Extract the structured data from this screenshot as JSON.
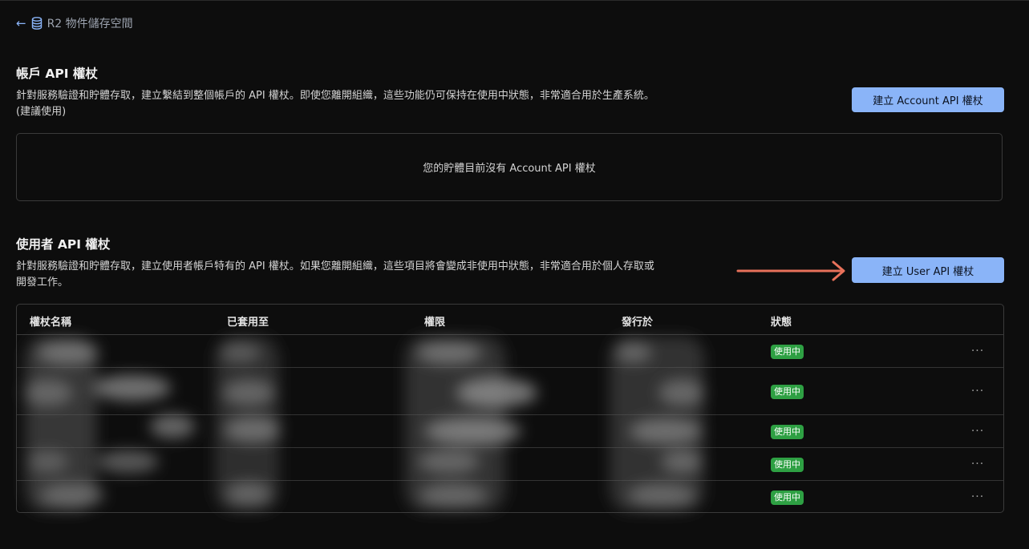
{
  "breadcrumb": {
    "back_icon": "arrow-left-icon",
    "db_icon": "database-icon",
    "label": "R2 物件儲存空間"
  },
  "account_section": {
    "title": "帳戶 API 權杖",
    "description": "針對服務驗證和貯體存取，建立繫結到整個帳戶的 API 權杖。即使您離開組織，這些功能仍可保持在使用中狀態，非常適合用於生產系統。(建議使用)",
    "button_label": "建立 Account API 權杖",
    "empty_message": "您的貯體目前沒有 Account API 權杖"
  },
  "user_section": {
    "title": "使用者 API 權杖",
    "description": "針對服務驗證和貯體存取，建立使用者帳戶特有的 API 權杖。如果您離開組織，這些項目將會變成非使用中狀態，非常適合用於個人存取或開發工作。",
    "button_label": "建立 User API 權杖"
  },
  "table": {
    "columns": [
      "權杖名稱",
      "已套用至",
      "權限",
      "發行於",
      "狀態"
    ],
    "rows": [
      {
        "status": "使用中",
        "menu": "···"
      },
      {
        "status": "使用中",
        "menu": "···"
      },
      {
        "status": "使用中",
        "menu": "···"
      },
      {
        "status": "使用中",
        "menu": "···"
      },
      {
        "status": "使用中",
        "menu": "···"
      }
    ]
  },
  "colors": {
    "accent": "#8ab4f8",
    "status_active": "#2ea043",
    "annotation_arrow": "#e8715a",
    "background": "#0d0d0d"
  }
}
